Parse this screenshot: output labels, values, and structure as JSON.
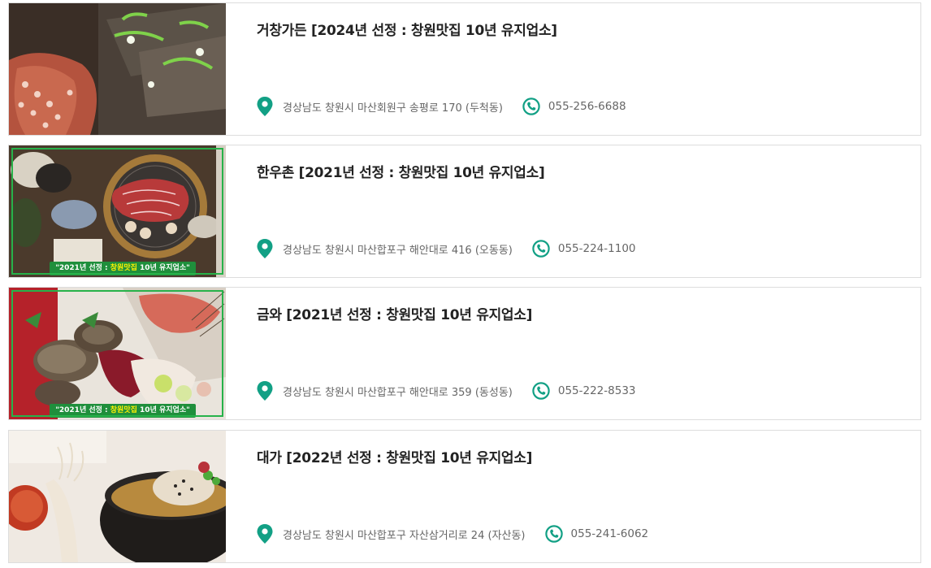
{
  "accent_color": "#12a085",
  "restaurants": [
    {
      "title": "거창가든 [2024년 선정 : 창원맛집 10년 유지업소]",
      "address": "경상남도 창원시 마산회원구 송평로 170 (두척동)",
      "phone": "055-256-6688",
      "photo": "octopus-and-grilled-food-photo",
      "banner": null
    },
    {
      "title": "한우촌 [2021년 선정 : 창원맛집 10년 유지업소]",
      "address": "경상남도 창원시 마산합포구 해안대로 416 (오동동)",
      "phone": "055-224-1100",
      "photo": "korean-beef-grill-table-photo",
      "banner": {
        "prefix": "\"2021년 선정 : ",
        "highlight": "창원맛집",
        "suffix": " 10년 유지업소\""
      }
    },
    {
      "title": "금와 [2021년 선정 : 창원맛집 10년 유지업소]",
      "address": "경상남도 창원시 마산합포구 해안대로 359 (동성동)",
      "phone": "055-222-8533",
      "photo": "abalone-and-sashimi-platter-photo",
      "banner": {
        "prefix": "\"2021년 선정 : ",
        "highlight": "창원맛집",
        "suffix": " 10년 유지업소\""
      }
    },
    {
      "title": "대가 [2022년 선정 : 창원맛집 10년 유지업소]",
      "address": "경상남도 창원시 마산합포구 자산삼거리로 24 (자산동)",
      "phone": "055-241-6062",
      "photo": "samgyetang-stone-pot-photo",
      "banner": null
    }
  ]
}
